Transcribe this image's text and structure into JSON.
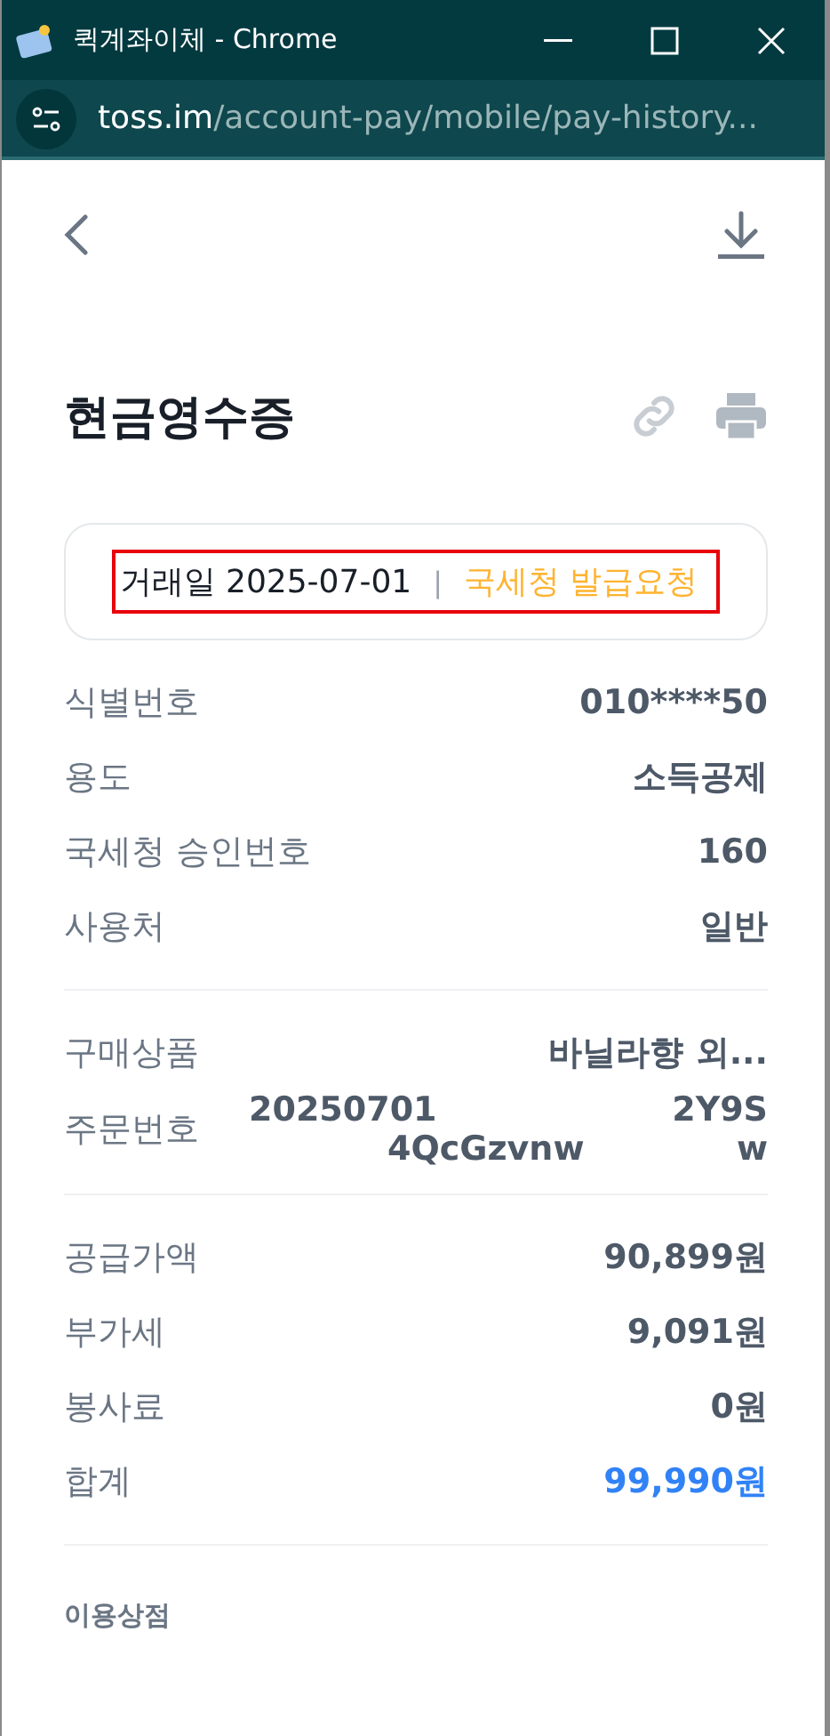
{
  "window": {
    "title": "퀵계좌이체 - Chrome"
  },
  "address_bar": {
    "host": "toss.im",
    "path": "/account-pay/mobile/pay-history..."
  },
  "page": {
    "title": "현금영수증"
  },
  "summary": {
    "date": "거래일 2025-07-01",
    "separator": "|",
    "action": "국세청 발급요청"
  },
  "sections": [
    {
      "rows": [
        {
          "label": "식별번호",
          "value": [
            "010****50"
          ]
        },
        {
          "label": "용도",
          "value": [
            "소득공제"
          ]
        },
        {
          "label": "국세청 승인번호",
          "value": [
            "160"
          ]
        },
        {
          "label": "사용처",
          "value": [
            "일반"
          ]
        }
      ]
    },
    {
      "rows": [
        {
          "label": "구매상품",
          "value": [
            "바닐라향 외..."
          ]
        },
        {
          "label": "주문번호",
          "value": [
            "20250701",
            "2Y9S"
          ],
          "value_line_2": [
            "4QcGzvnw",
            "w"
          ]
        }
      ]
    },
    {
      "rows": [
        {
          "label": "공급가액",
          "value": [
            "90,899원"
          ]
        },
        {
          "label": "부가세",
          "value": [
            "9,091원"
          ]
        },
        {
          "label": "봉사료",
          "value": [
            "0원"
          ]
        },
        {
          "label": "합계",
          "value": [
            "99,990원"
          ],
          "highlight": true
        }
      ]
    }
  ],
  "footer_heading": "이용상점"
}
